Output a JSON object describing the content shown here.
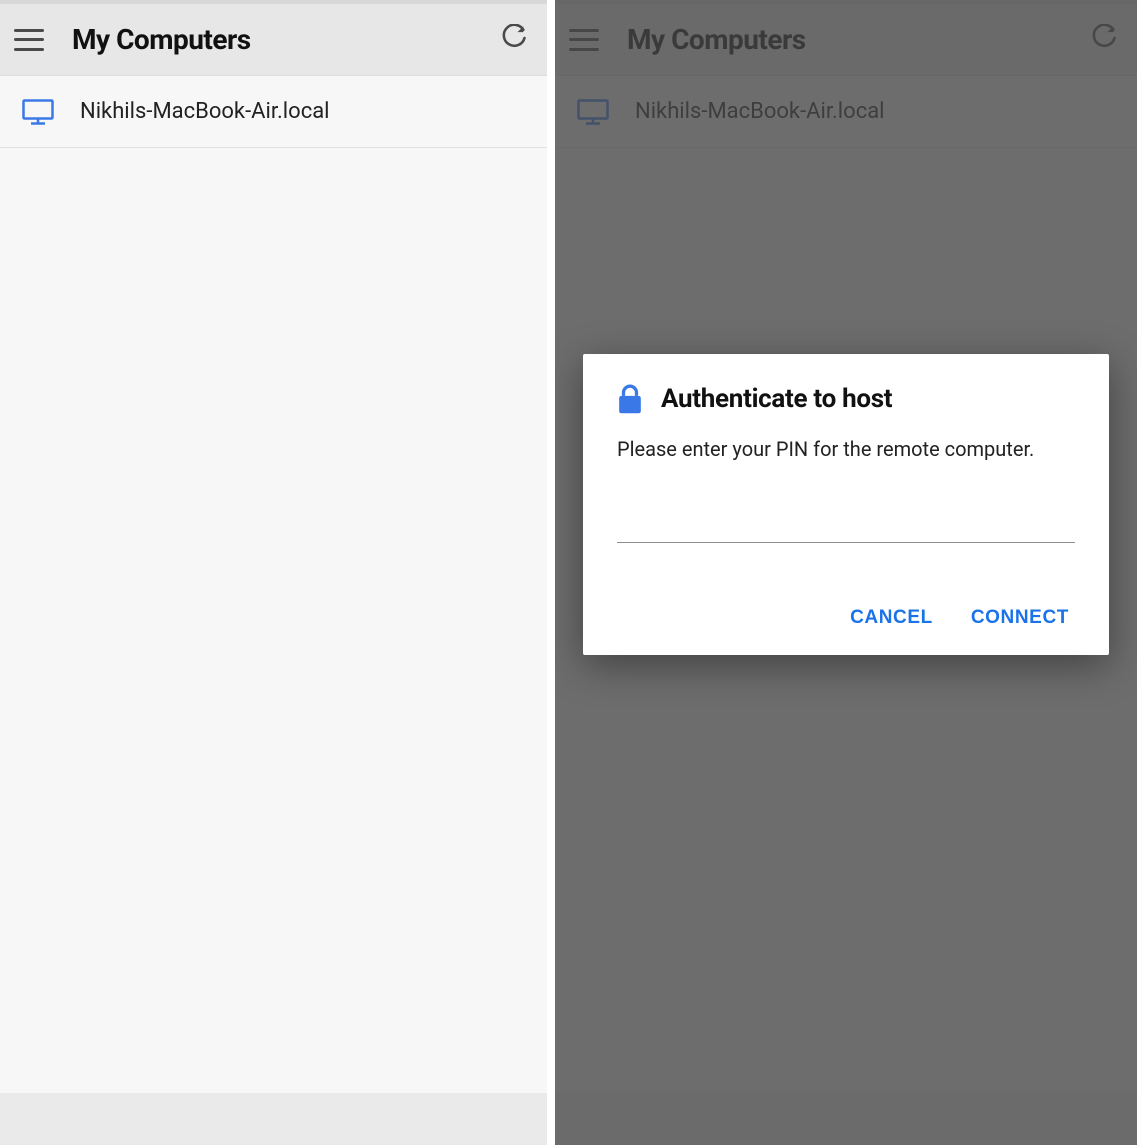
{
  "left": {
    "header": {
      "title": "My Computers"
    },
    "hosts": [
      {
        "name": "Nikhils-MacBook-Air.local"
      }
    ]
  },
  "right": {
    "header": {
      "title": "My Computers"
    },
    "hosts": [
      {
        "name": "Nikhils-MacBook-Air.local"
      }
    ],
    "dialog": {
      "title": "Authenticate to host",
      "description": "Please enter your PIN for the remote computer.",
      "pin_value": "",
      "pin_placeholder": "",
      "actions": {
        "cancel": "CANCEL",
        "connect": "CONNECT"
      }
    }
  },
  "colors": {
    "accent": "#1a73e8",
    "icon_blue": "#3b78e7"
  }
}
